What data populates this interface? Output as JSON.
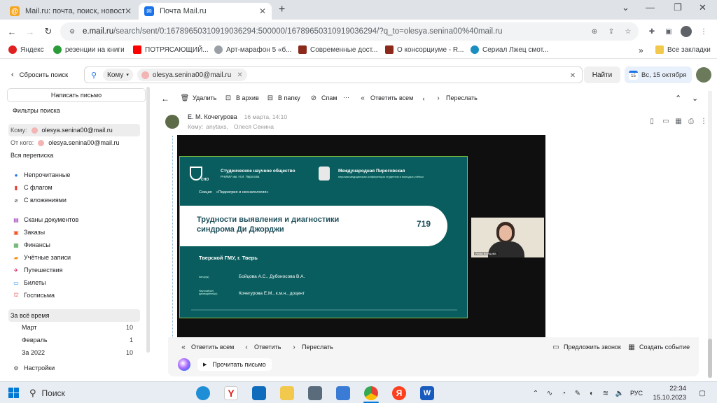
{
  "browser": {
    "tabs": [
      {
        "title": "Mail.ru: почта, поиск, новости,"
      },
      {
        "title": "Почта Mail.ru"
      }
    ],
    "url_host": "e.mail.ru",
    "url_rest": "/search/sent/0:16789650310919036294:500000/16789650310919036294/?q_to=olesya.senina00%40mail.ru",
    "bookmarks": [
      {
        "label": "Яндекс",
        "color": "#e02020"
      },
      {
        "label": "резенции на книги",
        "color": "#2a9d3a"
      },
      {
        "label": "ПОТРЯСАЮЩИЙ...",
        "color": "#ff0000"
      },
      {
        "label": "Арт-марафон 5 «б...",
        "color": "#9aa0a6"
      },
      {
        "label": "Современные дост...",
        "color": "#8b2a1a"
      },
      {
        "label": "О консорциуме - R...",
        "color": "#8b2a1a"
      },
      {
        "label": "Сериал Лжец смот...",
        "color": "#1a8fbf"
      }
    ],
    "bookmarks_more": "»",
    "all_bookmarks": "Все закладки"
  },
  "mail_header": {
    "reset_search": "Сбросить поиск",
    "filter_chip": "Кому",
    "email_chip": "olesya.senina00@mail.ru",
    "find_button": "Найти",
    "date_badge": "Вс, 15 октября",
    "calendar_day": "15"
  },
  "sidebar": {
    "compose": "Написать письмо",
    "filters_title": "Фильтры поиска",
    "to_label": "Кому:",
    "to_email": "olesya.senina00@mail.ru",
    "from_label": "От кого:",
    "from_email": "olesya.senina00@mail.ru",
    "all_correspondence": "Вся переписка",
    "filters": [
      {
        "label": "Непрочитанные",
        "icon": "unread-dot-icon",
        "color": "#1a73e8"
      },
      {
        "label": "С флагом",
        "icon": "flag-icon",
        "color": "#e53935"
      },
      {
        "label": "С вложениями",
        "icon": "paperclip-icon",
        "color": "#444444"
      }
    ],
    "categories": [
      {
        "label": "Сканы документов",
        "icon": "scan-icon",
        "color": "#8e24aa"
      },
      {
        "label": "Заказы",
        "icon": "cart-icon",
        "color": "#f4511e"
      },
      {
        "label": "Финансы",
        "icon": "finance-icon",
        "color": "#43a047"
      },
      {
        "label": "Учётные записи",
        "icon": "account-icon",
        "color": "#fb8c00"
      },
      {
        "label": "Путешествия",
        "icon": "travel-icon",
        "color": "#d81b60"
      },
      {
        "label": "Билеты",
        "icon": "ticket-icon",
        "color": "#1e88e5"
      },
      {
        "label": "Госписьма",
        "icon": "gov-icon",
        "color": "#e53935"
      }
    ],
    "period_header": "За всё время",
    "periods": [
      {
        "label": "Март",
        "count": "10"
      },
      {
        "label": "Февраль",
        "count": "1"
      },
      {
        "label": "За 2022",
        "count": "10"
      }
    ],
    "settings": "Настройки"
  },
  "message_toolbar": {
    "delete": "Удалить",
    "archive": "В архив",
    "to_folder": "В папку",
    "spam": "Спам",
    "more": "···",
    "reply_all": "Ответить всем",
    "forward": "Переслать"
  },
  "message": {
    "sender": "Е. М. Кочегурова",
    "date": "16 марта, 14:10",
    "to_prefix": "Кому:",
    "to_list": "anytaxs,",
    "to_second": "Олеся Сенина"
  },
  "slide": {
    "org_left": "Студенческое научное общество",
    "org_left_sub": "РНИМУ им. Н.И. Пирогова",
    "logo_text": "СНО",
    "org_right": "Международная Пироговская",
    "org_right_sub": "научная медицинская конференция студентов и молодых учёных",
    "section_label": "Секция",
    "section_name": "«Педиатрия и неонатология»",
    "title_line1": "Трудности выявления и диагностики",
    "title_line2": "синдрома Ди Джорджи",
    "number": "719",
    "university": "Тверской ГМУ, г. Тверь",
    "authors_label": "Автор(ы)",
    "authors": "Бойцова А.С., Дубоносова В.А.",
    "supervisor_label": "Научный(ые) руководитель(и)",
    "supervisor": "Кочегурова Е.М., к.м.н., доцент"
  },
  "camera": {
    "name": "Анна Бойцова"
  },
  "bottom_bar": {
    "reply_all": "Ответить всем",
    "reply": "Ответить",
    "forward": "Переслать",
    "suggest_call": "Предложить звонок",
    "create_event": "Создать событие",
    "read_letter": "Прочитать письмо"
  },
  "taskbar": {
    "search": "Поиск",
    "lang": "РУС",
    "time": "22:34",
    "date": "15.10.2023"
  }
}
